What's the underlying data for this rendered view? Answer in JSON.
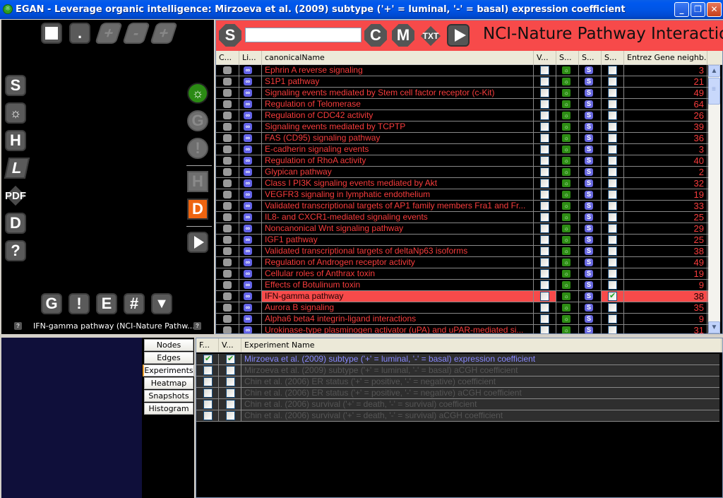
{
  "window": {
    "title": "EGAN - Leverage organic intelligence: Mirzoeva et al. (2009) subtype ('+' = luminal, '-' = basal) expression coefficient",
    "app_icon": "gear-icon",
    "controls": {
      "minimize": "_",
      "restore": "❐",
      "close": "✕"
    }
  },
  "left_panel": {
    "top_buttons": [
      {
        "name": "white-square",
        "label": ""
      },
      {
        "name": "dot",
        "label": "."
      },
      {
        "name": "plus",
        "label": "+"
      },
      {
        "name": "minus",
        "label": "-"
      },
      {
        "name": "plus2",
        "label": "+"
      }
    ],
    "side_buttons": [
      {
        "name": "s",
        "label": "S"
      },
      {
        "name": "settings",
        "label": "☼"
      },
      {
        "name": "h",
        "label": "H"
      },
      {
        "name": "l",
        "label": "L"
      },
      {
        "name": "pdf",
        "label": "PDF"
      },
      {
        "name": "d",
        "label": "D"
      },
      {
        "name": "help",
        "label": "?"
      }
    ],
    "right_buttons": [
      {
        "name": "gear-green",
        "label": "☼"
      },
      {
        "name": "g",
        "label": "G"
      },
      {
        "name": "exclaim",
        "label": "!"
      },
      {
        "name": "h",
        "label": "H"
      },
      {
        "name": "d-orange",
        "label": "D"
      },
      {
        "name": "play",
        "label": ""
      }
    ],
    "bottom_buttons": [
      {
        "name": "g",
        "label": "G"
      },
      {
        "name": "exclaim",
        "label": "!"
      },
      {
        "name": "e",
        "label": "E"
      },
      {
        "name": "hash",
        "label": "#"
      },
      {
        "name": "down",
        "label": "▼"
      }
    ],
    "help_label": "?",
    "status": "IFN-gamma pathway (NCI-Nature Pathw..."
  },
  "right_panel": {
    "toolbar": {
      "s_label": "S",
      "search_value": "",
      "c_label": "C",
      "m_label": "M",
      "txt_label": "TXT"
    },
    "database_title": "NCI-Nature Pathway Interaction",
    "columns": [
      "C...",
      "Li...",
      "canonicalName",
      "V...",
      "S...",
      "S...",
      "S...",
      "Entrez Gene neighb..."
    ],
    "rows": [
      {
        "name": "Ephrin A  reverse signaling",
        "count": "3",
        "v": false,
        "s3": false,
        "selected": false
      },
      {
        "name": "S1P1 pathway",
        "count": "21",
        "v": false,
        "s3": false,
        "selected": false
      },
      {
        "name": "Signaling events mediated by Stem cell factor receptor (c-Kit)",
        "count": "49",
        "v": false,
        "s3": false,
        "selected": false
      },
      {
        "name": "Regulation of Telomerase",
        "count": "64",
        "v": false,
        "s3": false,
        "selected": false
      },
      {
        "name": "Regulation of CDC42 activity",
        "count": "26",
        "v": false,
        "s3": false,
        "selected": false
      },
      {
        "name": "Signaling events mediated by TCPTP",
        "count": "39",
        "v": false,
        "s3": false,
        "selected": false
      },
      {
        "name": "FAS (CD95) signaling pathway",
        "count": "36",
        "v": false,
        "s3": false,
        "selected": false
      },
      {
        "name": "E-cadherin signaling events",
        "count": "3",
        "v": false,
        "s3": false,
        "selected": false
      },
      {
        "name": "Regulation of RhoA activity",
        "count": "40",
        "v": false,
        "s3": false,
        "selected": false
      },
      {
        "name": "Glypican pathway",
        "count": "2",
        "v": false,
        "s3": false,
        "selected": false
      },
      {
        "name": "Class I PI3K signaling events mediated by Akt",
        "count": "32",
        "v": false,
        "s3": false,
        "selected": false
      },
      {
        "name": "VEGFR3 signaling in lymphatic endothelium",
        "count": "19",
        "v": false,
        "s3": false,
        "selected": false
      },
      {
        "name": "Validated transcriptional targets of AP1 family members Fra1 and Fr...",
        "count": "33",
        "v": false,
        "s3": false,
        "selected": false
      },
      {
        "name": "IL8- and CXCR1-mediated signaling events",
        "count": "25",
        "v": false,
        "s3": false,
        "selected": false
      },
      {
        "name": "Noncanonical Wnt signaling pathway",
        "count": "29",
        "v": false,
        "s3": false,
        "selected": false
      },
      {
        "name": "IGF1 pathway",
        "count": "25",
        "v": false,
        "s3": false,
        "selected": false
      },
      {
        "name": "Validated transcriptional targets of deltaNp63 isoforms",
        "count": "38",
        "v": false,
        "s3": false,
        "selected": false
      },
      {
        "name": "Regulation of Androgen receptor activity",
        "count": "49",
        "v": false,
        "s3": false,
        "selected": false
      },
      {
        "name": "Cellular roles of Anthrax toxin",
        "count": "19",
        "v": false,
        "s3": false,
        "selected": false
      },
      {
        "name": "Effects of Botulinum toxin",
        "count": "9",
        "v": false,
        "s3": false,
        "selected": false
      },
      {
        "name": "IFN-gamma pathway",
        "count": "38",
        "v": false,
        "s3": true,
        "selected": true
      },
      {
        "name": "Aurora B signaling",
        "count": "35",
        "v": false,
        "s3": false,
        "selected": false
      },
      {
        "name": "Alpha6 beta4 integrin-ligand interactions",
        "count": "9",
        "v": false,
        "s3": false,
        "selected": false
      },
      {
        "name": "Urokinase-type plasminogen activator (uPA) and uPAR-mediated si...",
        "count": "31",
        "v": false,
        "s3": false,
        "selected": false
      }
    ],
    "cell_icons": {
      "link": "∞",
      "gear": "☼",
      "s": "S"
    },
    "scroll": {
      "up": "▲",
      "down": "▼"
    }
  },
  "bottom": {
    "tabs": [
      {
        "label": "Nodes",
        "active": false
      },
      {
        "label": "Edges",
        "active": false
      },
      {
        "label": "Experiments",
        "active": true
      },
      {
        "label": "Heatmap",
        "active": false
      },
      {
        "label": "Snapshots",
        "active": false
      },
      {
        "label": "Histogram",
        "active": false
      }
    ],
    "experiments": {
      "columns": [
        "F...",
        "V...",
        "Experiment Name"
      ],
      "rows": [
        {
          "name": "Mirzoeva et al. (2009) subtype ('+' = luminal, '-' = basal) expression coefficient",
          "f": true,
          "v": true,
          "active": true
        },
        {
          "name": "Mirzoeva et al. (2009) subtype ('+' = luminal, '-' = basal) aCGH coefficient",
          "f": false,
          "v": false,
          "active": false
        },
        {
          "name": "Chin et al. (2006) ER status ('+' = positive, '-' = negative) coefficient",
          "f": false,
          "v": false,
          "active": false
        },
        {
          "name": "Chin et al. (2006) ER status ('+' = positive, '-' = negative) aCGH coefficient",
          "f": false,
          "v": false,
          "active": false
        },
        {
          "name": "Chin et al. (2006) survival ('+' = death, '-' = survival) coefficient",
          "f": false,
          "v": false,
          "active": false
        },
        {
          "name": "Chin et al. (2006) survival ('+' = death, '-' = survival) aCGH coefficient",
          "f": false,
          "v": false,
          "active": false
        }
      ]
    }
  },
  "colors": {
    "accent_red": "#f74a4a",
    "text_red": "#f73c3c",
    "active_blue": "#8888ff",
    "green": "#2d8c14",
    "orange": "#ee6410"
  }
}
